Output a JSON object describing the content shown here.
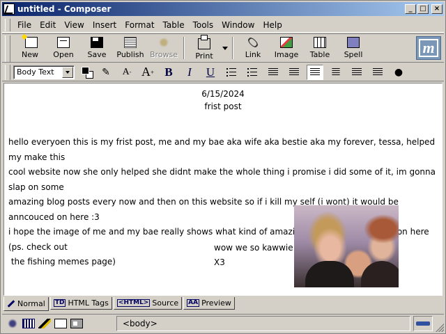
{
  "window": {
    "title": "untitled - Composer",
    "controls": [
      "minimize",
      "maximize",
      "close"
    ]
  },
  "menubar": {
    "items": [
      "File",
      "Edit",
      "View",
      "Insert",
      "Format",
      "Table",
      "Tools",
      "Window",
      "Help"
    ]
  },
  "toolbar": {
    "new": "New",
    "open": "Open",
    "save": "Save",
    "publish": "Publish",
    "browse": "Browse",
    "print": "Print",
    "link": "Link",
    "image": "Image",
    "table": "Table",
    "spell": "Spell",
    "icons": [
      "new-icon",
      "open-icon",
      "save-icon",
      "publish-icon",
      "browse-icon",
      "print-icon",
      "link-icon",
      "image-icon",
      "table-icon",
      "spell-icon"
    ],
    "browse_disabled": true
  },
  "format": {
    "paragraph_style": "Body Text",
    "text_color": "#000000",
    "background_color": "#ffffff",
    "bold": "B",
    "italic": "I",
    "underline": "U",
    "active_align": "left"
  },
  "document": {
    "date": "6/15/2024",
    "post_title": "frist post",
    "body_lines": [
      "hello everyoen this is my frist post, me and my bae aka wife aka bestie aka my forever, tessa, helped my make this",
      "cool website now she only helped she didnt make the whole thing i promise i did some of it, im gonna slap on some",
      "amazing blog posts every now and then on this website so if i kill my self (i wont) it would be anncouced on here :3",
      "i hope the image of me and my bae really shows what kind of amazing content we will have on here (ps. check out",
      " the fishing memes page)"
    ],
    "caption_line1": "wow we so kawwie",
    "caption_line2": "X3"
  },
  "modetabs": {
    "normal": "Normal",
    "html_tags": "HTML Tags",
    "source": "Source",
    "preview": "Preview",
    "active": "Normal"
  },
  "statusbar": {
    "path": "<body>"
  }
}
